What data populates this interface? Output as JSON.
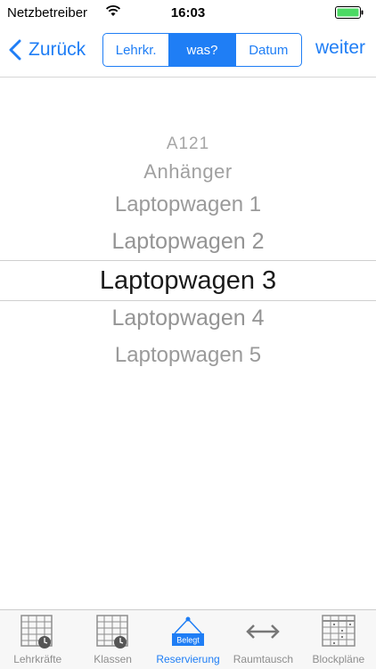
{
  "status_bar": {
    "carrier": "Netzbetreiber",
    "time": "16:03",
    "battery_color": "#4cd964"
  },
  "nav": {
    "back_label": "Zurück",
    "next_label": "weiter",
    "segments": [
      {
        "label": "Lehrkr.",
        "selected": false
      },
      {
        "label": "was?",
        "selected": true
      },
      {
        "label": "Datum",
        "selected": false
      }
    ]
  },
  "picker": {
    "items": [
      "A121",
      "Anhänger",
      "Laptopwagen 1",
      "Laptopwagen 2",
      "Laptopwagen 3",
      "Laptopwagen 4",
      "Laptopwagen 5"
    ],
    "selected": "Laptopwagen 3"
  },
  "tabs": [
    {
      "label": "Lehrkräfte",
      "icon": "grid-clock-icon",
      "active": false
    },
    {
      "label": "Klassen",
      "icon": "grid-clock-icon",
      "active": false
    },
    {
      "label": "Reservierung",
      "icon": "belegt-sign-icon",
      "badge": "Belegt",
      "active": true
    },
    {
      "label": "Raumtausch",
      "icon": "double-arrow-icon",
      "active": false
    },
    {
      "label": "Blockpläne",
      "icon": "grid-dots-icon",
      "active": false
    }
  ],
  "accent_color": "#1f7ef5"
}
